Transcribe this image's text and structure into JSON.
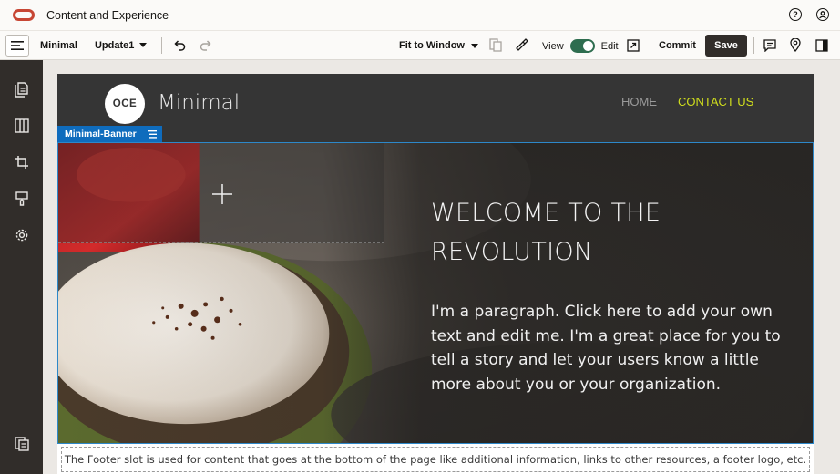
{
  "app": {
    "title": "Content and Experience"
  },
  "toolbar": {
    "site_name": "Minimal",
    "update": "Update1",
    "fit": "Fit to Window",
    "view_label": "View",
    "edit_label": "Edit",
    "edit_mode_on": true,
    "commit_label": "Commit",
    "save_label": "Save"
  },
  "site": {
    "logo_text": "OCE",
    "brand": "Minimal",
    "nav": [
      "HOME",
      "CONTACT US"
    ],
    "nav_active_color": "#d0de1d"
  },
  "banner": {
    "tag": "Minimal-Banner",
    "heading_line1": "WELCOME TO THE",
    "heading_line2": "REVOLUTION",
    "paragraph": "I'm a paragraph. Click here to add your own text and edit me. I'm a great place for you to tell a story and let your users know a little more about you or your organization."
  },
  "footer": {
    "text": "The Footer slot is used for content that goes at the bottom of the page like additional information, links to other resources, a footer logo, etc."
  },
  "colors": {
    "brand_red": "#c74634",
    "sidebar": "#312d2a",
    "save_bg": "#312d2a",
    "toggle_on": "#2e6d4f",
    "selection_blue": "#0f6cbd"
  }
}
